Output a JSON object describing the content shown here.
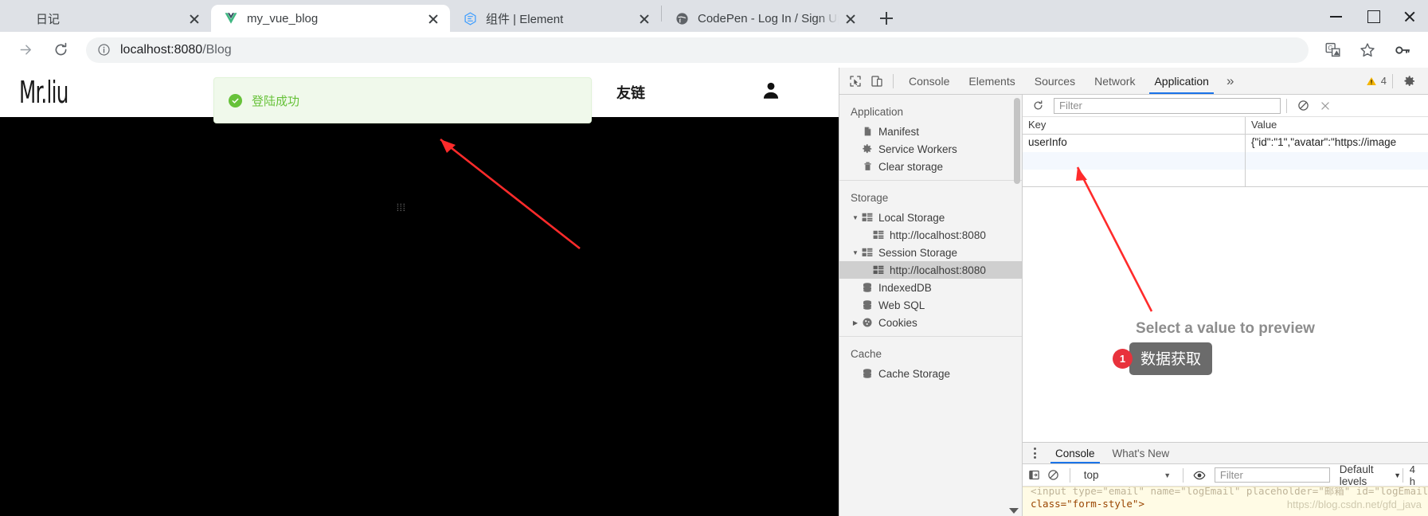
{
  "browser": {
    "tabs": [
      {
        "title": "日记",
        "favicon": "none",
        "active": false
      },
      {
        "title": "my_vue_blog",
        "favicon": "vue-icon",
        "active": true
      },
      {
        "title": "组件 | Element",
        "favicon": "element-icon",
        "active": false
      },
      {
        "title": "CodePen - Log In / Sign Up - p",
        "favicon": "globe-icon",
        "active": false
      }
    ],
    "new_tab_label": "+",
    "window_controls": [
      "minimize-icon",
      "maximize-icon",
      "close-icon"
    ],
    "toolbar": {
      "back_icon": "arrow-back-icon",
      "forward_icon": "arrow-forward-icon",
      "reload_icon": "reload-icon",
      "site_info_icon": "info-circle-icon",
      "url_prefix": "localhost:8080",
      "url_suffix": "/Blog",
      "url_full": "localhost:8080/Blog",
      "right_icons": [
        "translate-icon",
        "bookmark-star-icon",
        "password-key-icon"
      ]
    }
  },
  "page": {
    "brand": "Mr.liu",
    "nav_link": "友链",
    "avatar_icon": "user-avatar-icon",
    "toast": {
      "text": "登陆成功",
      "icon": "success-check-icon",
      "bg": "#f0f9eb",
      "color": "#67c23a"
    },
    "drag_handle": "⦙⦙⦙"
  },
  "devtools": {
    "tabs": [
      {
        "label": "Console",
        "active": false
      },
      {
        "label": "Elements",
        "active": false
      },
      {
        "label": "Sources",
        "active": false
      },
      {
        "label": "Network",
        "active": false
      },
      {
        "label": "Application",
        "active": true
      }
    ],
    "overflow_label": "»",
    "warning_count": "4",
    "settings_icon": "gear-icon",
    "inspect_icon": "inspect-element-icon",
    "device_icon": "device-toolbar-icon",
    "sidebar": {
      "application_title": "Application",
      "application_items": [
        {
          "label": "Manifest",
          "icon": "manifest-file-icon"
        },
        {
          "label": "Service Workers",
          "icon": "gear-icon"
        },
        {
          "label": "Clear storage",
          "icon": "trash-icon"
        }
      ],
      "storage_title": "Storage",
      "storage_items": [
        {
          "label": "Local Storage",
          "icon": "table-icon",
          "arrow": "▼",
          "indent": 0,
          "selected": false
        },
        {
          "label": "http://localhost:8080",
          "icon": "table-icon",
          "arrow": "",
          "indent": 1,
          "selected": false
        },
        {
          "label": "Session Storage",
          "icon": "table-icon",
          "arrow": "▼",
          "indent": 0,
          "selected": false
        },
        {
          "label": "http://localhost:8080",
          "icon": "table-icon",
          "arrow": "",
          "indent": 1,
          "selected": true
        },
        {
          "label": "IndexedDB",
          "icon": "database-icon",
          "arrow": "",
          "indent": 0,
          "selected": false
        },
        {
          "label": "Web SQL",
          "icon": "database-icon",
          "arrow": "",
          "indent": 0,
          "selected": false
        },
        {
          "label": "Cookies",
          "icon": "cookie-icon",
          "arrow": "▶",
          "indent": 0,
          "selected": false
        }
      ],
      "cache_title": "Cache",
      "cache_items": [
        {
          "label": "Cache Storage",
          "icon": "database-icon"
        }
      ]
    },
    "storage_toolbar": {
      "refresh_icon": "refresh-icon",
      "filter_placeholder": "Filter",
      "clear_all_icon": "clear-all-icon",
      "delete_icon": "delete-x-icon"
    },
    "storage_table": {
      "columns": [
        "Key",
        "Value"
      ],
      "rows": [
        {
          "key": "userInfo",
          "value": "{\"id\":\"1\",\"avatar\":\"https://image"
        }
      ]
    },
    "preview_placeholder": "Select a value to preview",
    "drawer": {
      "tabs": [
        {
          "label": "Console",
          "active": true
        },
        {
          "label": "What's New",
          "active": false
        }
      ],
      "kebab_icon": "more-options-icon",
      "sidebar_toggle_icon": "console-sidebar-icon",
      "clear_icon": "clear-console-icon",
      "context": "top",
      "eye_icon": "live-expression-icon",
      "filter_placeholder": "Filter",
      "levels_label": "Default levels",
      "hidden_label": "4 h",
      "message_line1": "<input type=\"email\" name=\"logEmail\" placeholder=\"邮箱\" id=\"logEmail\" autocomplete=",
      "message_line2": "class=\"form-style\">",
      "watermark": "https://blog.csdn.net/gfd_java"
    }
  },
  "annotations": {
    "callout_badge": "1",
    "callout_text": "数据获取",
    "arrow_color": "#ff2b2b"
  }
}
